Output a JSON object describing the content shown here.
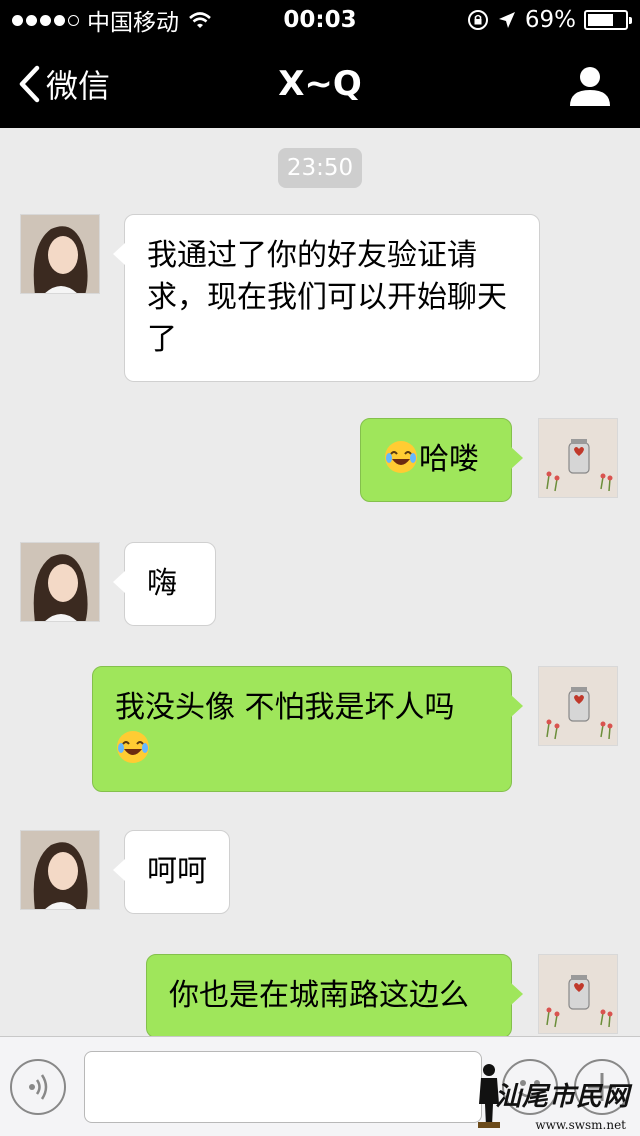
{
  "status_bar": {
    "carrier": "中国移动",
    "time": "00:03",
    "battery_percent": "69%",
    "battery_level": 0.69,
    "signal_bars_filled": 4,
    "signal_bars_total": 5,
    "icons": [
      "wifi-icon",
      "rotation-lock-icon",
      "location-arrow-icon",
      "battery-icon"
    ]
  },
  "nav": {
    "back_label": "微信",
    "title": "X~Q",
    "right_icon": "profile-icon"
  },
  "chat": {
    "timestamp": "23:50",
    "messages": [
      {
        "side": "left",
        "text": "我通过了你的好友验证请求，现在我们可以开始聊天了",
        "emoji": ""
      },
      {
        "side": "right",
        "text": "哈喽",
        "emoji": "tears-of-joy-emoji"
      },
      {
        "side": "left",
        "text": "嗨",
        "emoji": ""
      },
      {
        "side": "right",
        "text": "我没头像 不怕我是坏人吗",
        "emoji": "tears-of-joy-emoji"
      },
      {
        "side": "left",
        "text": "呵呵",
        "emoji": ""
      },
      {
        "side": "right",
        "text": "你也是在城南路这边么",
        "emoji": ""
      }
    ]
  },
  "input_bar": {
    "text_value": "",
    "icons": [
      "voice-icon",
      "emoji-icon",
      "plus-icon"
    ]
  },
  "watermark": {
    "text": "汕尾市民网",
    "url": "www.swsm.net"
  },
  "colors": {
    "bar_background": "#000000",
    "chat_background": "#ebebeb",
    "sent_bubble": "#9fe65b",
    "received_bubble": "#ffffff"
  }
}
